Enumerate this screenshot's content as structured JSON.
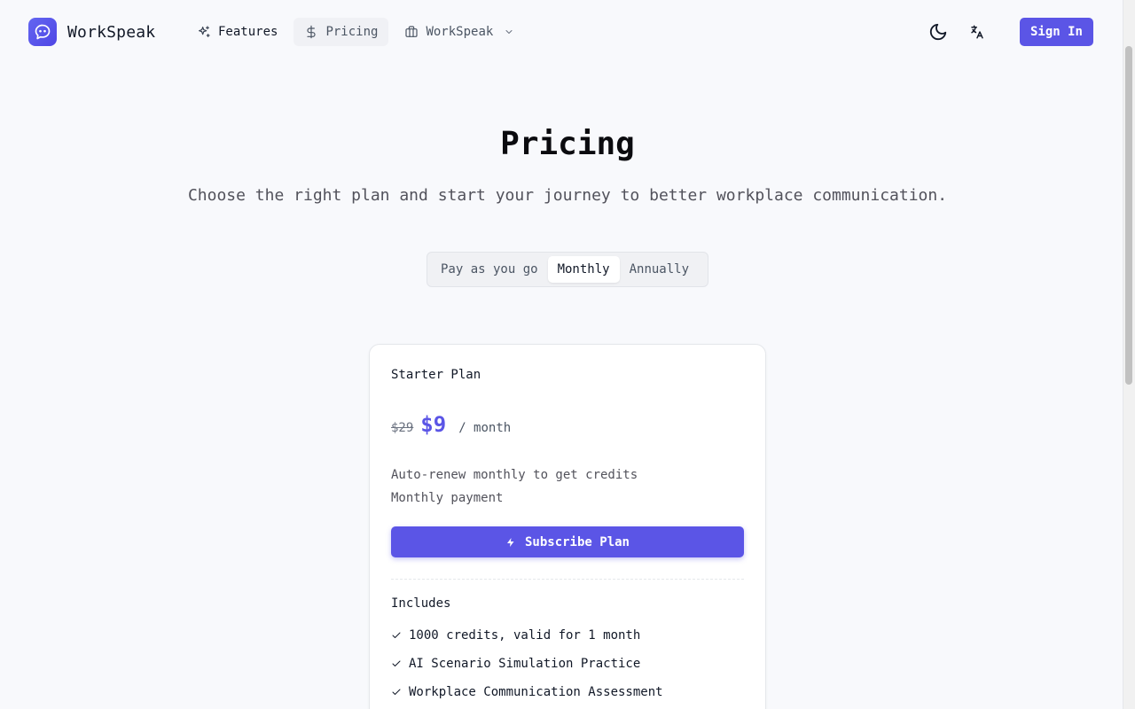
{
  "brand": {
    "name": "WorkSpeak",
    "accent": "#5b55e6"
  },
  "nav": {
    "items": [
      {
        "label": "Features",
        "icon": "sparkles-icon"
      },
      {
        "label": "Pricing",
        "icon": "dollar-icon"
      },
      {
        "label": "WorkSpeak",
        "icon": "briefcase-icon"
      }
    ]
  },
  "header": {
    "signin_label": "Sign In"
  },
  "hero": {
    "title": "Pricing",
    "subtitle": "Choose the right plan and start your journey to better workplace communication."
  },
  "billing": {
    "options": [
      "Pay as you go",
      "Monthly",
      "Annually"
    ],
    "selected": "Monthly"
  },
  "plan": {
    "name": "Starter Plan",
    "old_price": "$29",
    "price": "$9",
    "period": "/ month",
    "desc1": "Auto-renew monthly to get credits",
    "desc2": "Monthly payment",
    "cta": "Subscribe Plan",
    "includes_label": "Includes",
    "features": [
      "1000 credits, valid for 1 month",
      "AI Scenario Simulation Practice",
      "Workplace Communication Assessment"
    ]
  }
}
